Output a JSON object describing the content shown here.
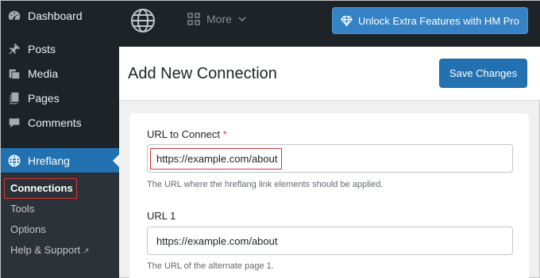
{
  "sidebar": {
    "items": [
      {
        "label": "Dashboard",
        "icon": "dashboard-icon"
      },
      {
        "label": "Posts",
        "icon": "pin-icon"
      },
      {
        "label": "Media",
        "icon": "media-icon"
      },
      {
        "label": "Pages",
        "icon": "pages-icon"
      },
      {
        "label": "Comments",
        "icon": "comment-icon"
      },
      {
        "label": "Hreflang",
        "icon": "globe-icon"
      }
    ],
    "submenu": [
      {
        "label": "Connections"
      },
      {
        "label": "Tools"
      },
      {
        "label": "Options"
      },
      {
        "label": "Help & Support"
      }
    ]
  },
  "topbar": {
    "more_label": "More",
    "pro_button_label": "Unlock Extra Features with HM Pro"
  },
  "header": {
    "title": "Add New Connection",
    "save_label": "Save Changes"
  },
  "form": {
    "url_label": "URL to Connect",
    "required_mark": "*",
    "url_value": "https://example.com/about",
    "url_help": "The URL where the hreflang link elements should be applied.",
    "url1_label": "URL 1",
    "url1_value": "https://example.com/about",
    "url1_help": "The URL of the alternate page 1."
  },
  "colors": {
    "accent": "#2271b1",
    "sidebar_bg": "#1d2327",
    "highlight": "#d63638"
  }
}
